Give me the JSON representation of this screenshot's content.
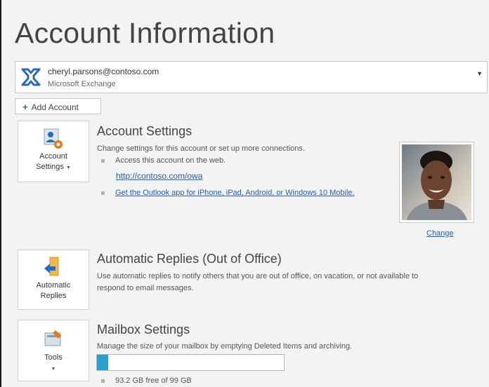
{
  "page": {
    "title": "Account Information"
  },
  "account": {
    "email": "cheryl.parsons@contoso.com",
    "type": "Microsoft Exchange",
    "dropdown_icon": "chevron-down-icon"
  },
  "add_account": {
    "label": "Add Account",
    "icon": "plus-icon"
  },
  "account_settings": {
    "tile_label_1": "Account",
    "tile_label_2": "Settings",
    "title": "Account Settings",
    "description": "Change settings for this account or set up more connections.",
    "bullet_web": "Access this account on the web.",
    "web_link": "http://contoso.com/owa",
    "app_link": "Get the Outlook app for iPhone, iPad, Android, or Windows 10 Mobile.",
    "change_label": "Change"
  },
  "automatic_replies": {
    "tile_label_1": "Automatic",
    "tile_label_2": "Replies",
    "title": "Automatic Replies (Out of Office)",
    "description_line1": "Use automatic replies to notify others that you are out of office, on vacation, or not available to",
    "description_line2": "respond to email messages."
  },
  "mailbox_settings": {
    "tile_label": "Tools",
    "title": "Mailbox Settings",
    "description": "Manage the size of your mailbox by emptying Deleted Items and archiving.",
    "usage_fraction": 0.06,
    "storage_text": "93.2 GB free of 99 GB"
  },
  "colors": {
    "accent_blue": "#2e9ecb",
    "link_blue": "#2a5da8",
    "exchange_blue": "#2a6bb5",
    "warning_orange": "#e07b1a"
  }
}
